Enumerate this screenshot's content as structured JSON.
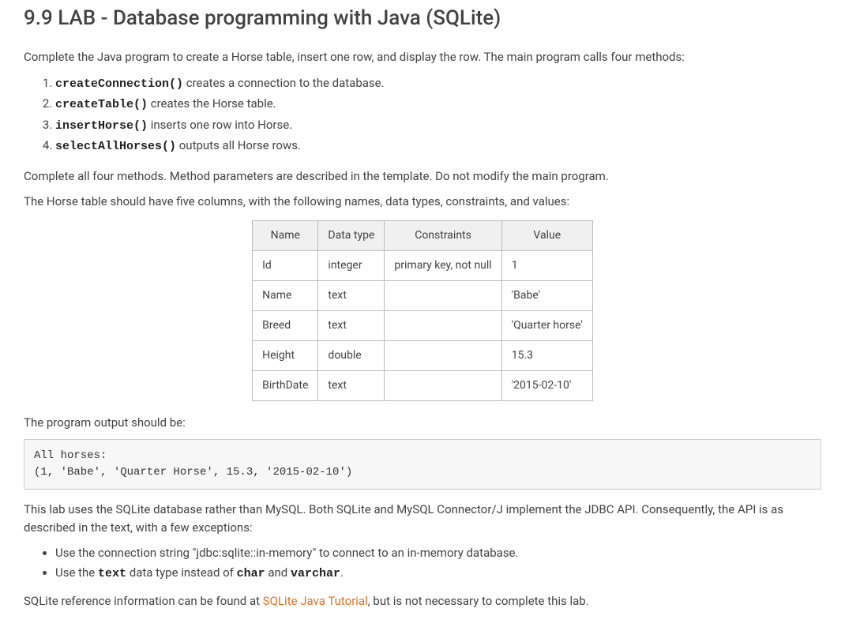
{
  "title": "9.9 LAB - Database programming with Java (SQLite)",
  "intro": "Complete the Java program to create a Horse table, insert one row, and display the row. The main program calls four methods:",
  "methods": [
    {
      "code": "createConnection()",
      "text": " creates a connection to the database."
    },
    {
      "code": "createTable()",
      "text": " creates the Horse table."
    },
    {
      "code": "insertHorse()",
      "text": " inserts one row into Horse."
    },
    {
      "code": "selectAllHorses()",
      "text": " outputs all Horse rows."
    }
  ],
  "para2": "Complete all four methods. Method parameters are described in the template. Do not modify the main program.",
  "para3": "The Horse table should have five columns, with the following names, data types, constraints, and values:",
  "table": {
    "headers": [
      "Name",
      "Data type",
      "Constraints",
      "Value"
    ],
    "rows": [
      [
        "Id",
        "integer",
        "primary key, not null",
        "1"
      ],
      [
        "Name",
        "text",
        "",
        "'Babe'"
      ],
      [
        "Breed",
        "text",
        "",
        "'Quarter horse'"
      ],
      [
        "Height",
        "double",
        "",
        "15.3"
      ],
      [
        "BirthDate",
        "text",
        "",
        "'2015-02-10'"
      ]
    ]
  },
  "para4": "The program output should be:",
  "output": "All horses:\n(1, 'Babe', 'Quarter Horse', 15.3, '2015-02-10')",
  "para5": "This lab uses the SQLite database rather than MySQL. Both SQLite and MySQL Connector/J implement the JDBC API. Consequently, the API is as described in the text, with a few exceptions:",
  "notes": {
    "n1a": "Use the connection string \"jdbc:sqlite::in-memory\" to connect to an in-memory database.",
    "n2a": "Use the ",
    "n2code1": "text",
    "n2b": " data type instead of ",
    "n2code2": "char",
    "n2c": " and ",
    "n2code3": "varchar",
    "n2d": "."
  },
  "para6a": "SQLite reference information can be found at ",
  "para6link": "SQLite Java Tutorial",
  "para6b": ", but is not necessary to complete this lab."
}
